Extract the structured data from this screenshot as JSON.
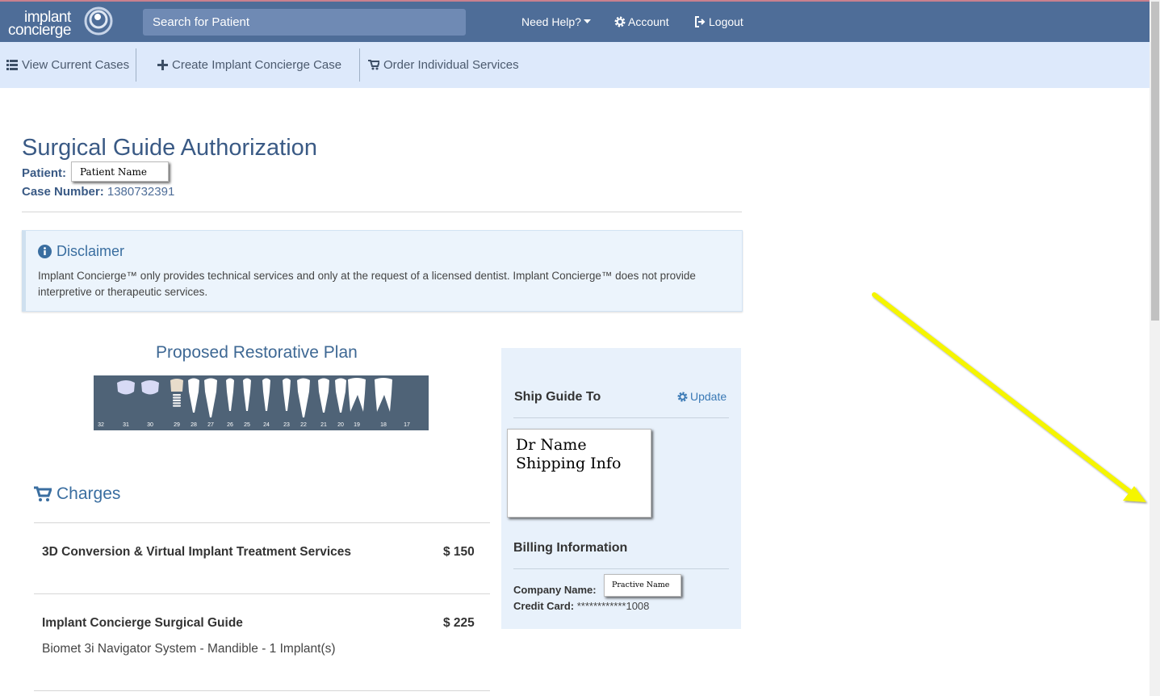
{
  "header": {
    "logo_line1": "implant",
    "logo_line2": "concierge",
    "search_placeholder": "Search for Patient",
    "need_help": "Need Help?",
    "account": "Account",
    "logout": "Logout"
  },
  "subnav": {
    "view_cases": "View Current Cases",
    "create_case": "Create Implant Concierge Case",
    "order_services": "Order Individual Services"
  },
  "page": {
    "title": "Surgical Guide Authorization",
    "patient_label": "Patient:",
    "patient_value": "Patient Name",
    "case_label": "Case Number:",
    "case_value": "1380732391"
  },
  "disclaimer": {
    "title": "Disclaimer",
    "text": "Implant Concierge™ only provides technical services and only at the request of a licensed dentist. Implant Concierge™ does not provide interpretive or therapeutic services."
  },
  "plan": {
    "title": "Proposed Restorative Plan",
    "teeth": [
      {
        "number": "32",
        "kind": "missing"
      },
      {
        "number": "31",
        "kind": "pontic"
      },
      {
        "number": "30",
        "kind": "pontic"
      },
      {
        "number": "29",
        "kind": "implant"
      },
      {
        "number": "28",
        "kind": "premolar"
      },
      {
        "number": "27",
        "kind": "canine"
      },
      {
        "number": "26",
        "kind": "incisor"
      },
      {
        "number": "25",
        "kind": "incisor"
      },
      {
        "number": "24",
        "kind": "incisor"
      },
      {
        "number": "23",
        "kind": "incisor"
      },
      {
        "number": "22",
        "kind": "canine"
      },
      {
        "number": "21",
        "kind": "premolar"
      },
      {
        "number": "20",
        "kind": "premolar"
      },
      {
        "number": "19",
        "kind": "molar"
      },
      {
        "number": "18",
        "kind": "molar"
      },
      {
        "number": "17",
        "kind": "missing"
      }
    ]
  },
  "charges": {
    "title": "Charges",
    "items": [
      {
        "name": "3D Conversion & Virtual Implant Treatment Services",
        "price": "$ 150",
        "detail": ""
      },
      {
        "name": "Implant Concierge Surgical Guide",
        "price": "$ 225",
        "detail": "Biomet 3i Navigator System - Mandible - 1 Implant(s)"
      }
    ]
  },
  "shipping": {
    "title": "Ship Guide To",
    "update": "Update",
    "note_line1": "Dr Name",
    "note_line2": "Shipping Info"
  },
  "billing": {
    "title": "Billing Information",
    "company_label": "Company Name:",
    "company_value": "Practive Name",
    "card_label": "Credit Card:",
    "card_value": "************1008"
  },
  "colors": {
    "topbar": "#4e6d98",
    "subbar": "#dde9fb",
    "heading": "#3a5a85",
    "annotation_arrow": "#f5f500"
  }
}
